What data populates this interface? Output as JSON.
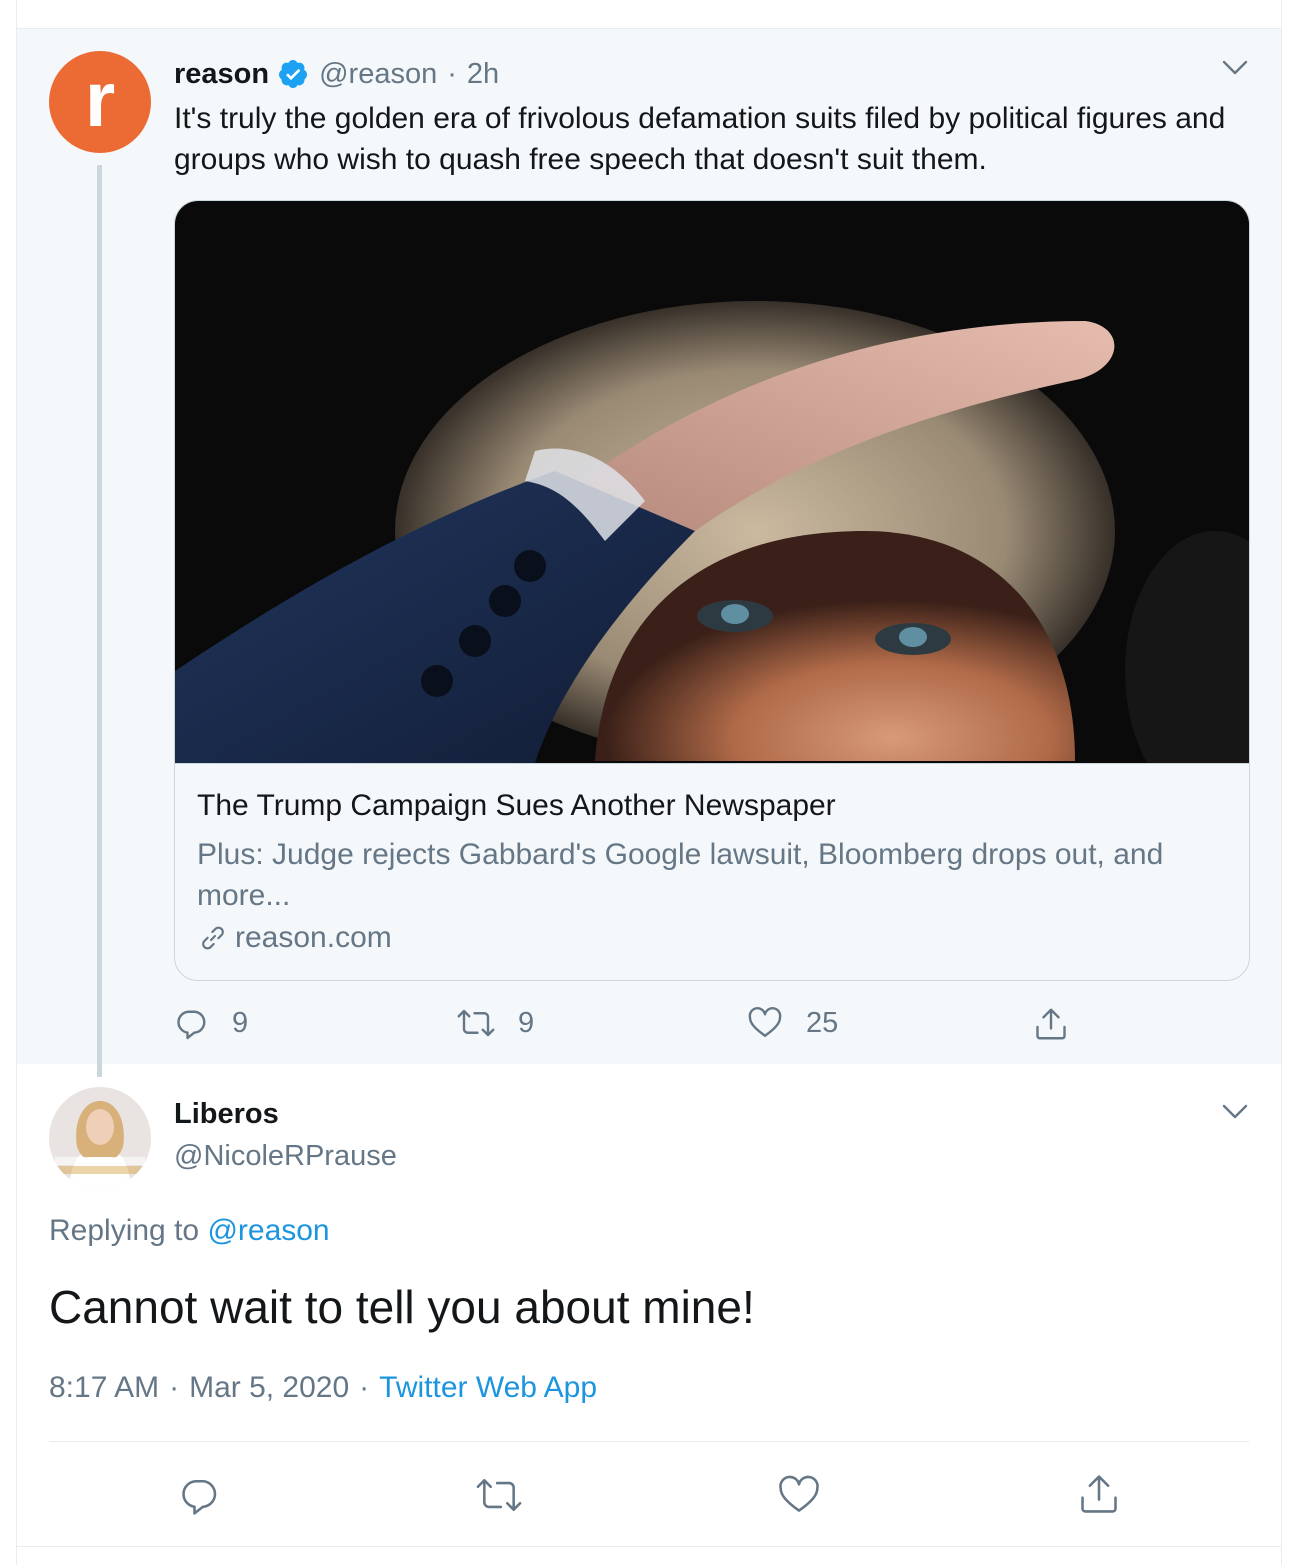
{
  "parent_tweet": {
    "avatar_letter": "r",
    "avatar_color": "#ec6b34",
    "name": "reason",
    "verified": true,
    "handle": "@reason",
    "separator": "·",
    "time": "2h",
    "text": "It's truly the golden era of frivolous defamation suits filed by political figures and groups who wish to quash free speech that doesn't suit them.",
    "card": {
      "title": "The Trump Campaign Sues Another Newspaper",
      "description": "Plus: Judge rejects Gabbard's Google lawsuit, Bloomberg drops out, and more...",
      "domain": "reason.com",
      "image_icon": "photo-of-man-shading-eyes"
    },
    "actions": {
      "reply_count": "9",
      "retweet_count": "9",
      "like_count": "25"
    }
  },
  "reply_tweet": {
    "name": "Liberos",
    "handle": "@NicoleRPrause",
    "replying_prefix": "Replying to",
    "replying_to": "@reason",
    "text": "Cannot wait to tell you about mine!",
    "time": "8:17 AM",
    "separator": "·",
    "date": "Mar 5, 2020",
    "source": "Twitter Web App"
  },
  "colors": {
    "link_blue": "#1b95e0",
    "verified_blue": "#1da1f2",
    "secondary_text": "#657786",
    "highlight_bg": "#f5f8fa"
  }
}
